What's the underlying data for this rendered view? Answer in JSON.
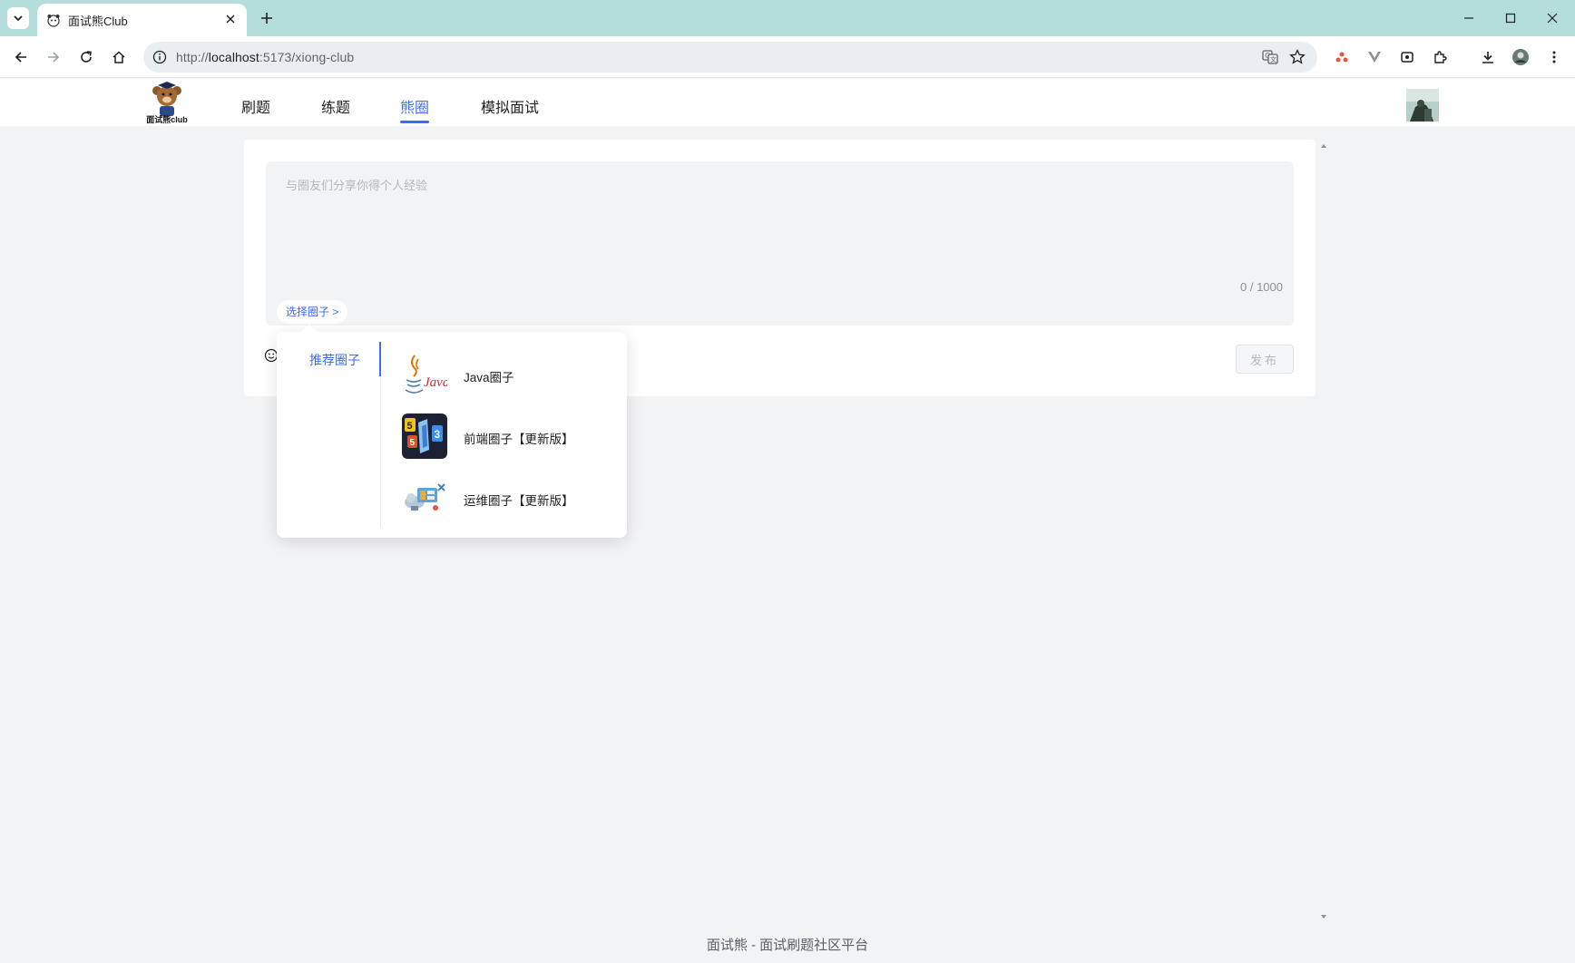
{
  "browser": {
    "tab_title": "面试熊Club",
    "url_prefix": "http://",
    "url_host": "localhost",
    "url_rest": ":5173/xiong-club"
  },
  "header": {
    "logo_text": "面试熊club",
    "nav": [
      {
        "label": "刷题"
      },
      {
        "label": "练题"
      },
      {
        "label": "熊圈"
      },
      {
        "label": "模拟面试"
      }
    ],
    "active_nav": "熊圈"
  },
  "composer": {
    "placeholder": "与圈友们分享你得个人经验",
    "value": "",
    "char_count": "0 / 1000",
    "circle_select_label": "选择圈子 >",
    "publish_label": "发布"
  },
  "circle_popover": {
    "category": "推荐圈子",
    "circles": [
      {
        "name": "Java圈子",
        "icon": "java-logo-icon"
      },
      {
        "name": "前端圈子【更新版】",
        "icon": "html-css-js-icon"
      },
      {
        "name": "运维圈子【更新版】",
        "icon": "ops-cloud-icon"
      }
    ]
  },
  "footer": {
    "text": "面试熊 - 面试刷题社区平台"
  },
  "colors": {
    "accent": "#3e6cf0",
    "tabbar": "#b4dedb",
    "page_bg": "#f2f3f5"
  }
}
